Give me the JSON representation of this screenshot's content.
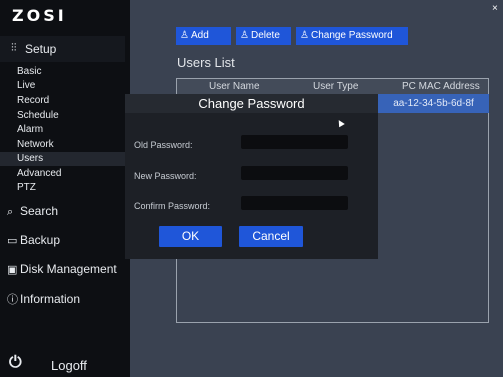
{
  "sidebar": {
    "logo": "ZOSI",
    "setup": {
      "icon": "settings-sliders-icon",
      "glyph": "⫶⫶",
      "label": "Setup"
    },
    "sub_items": [
      {
        "label": "Basic"
      },
      {
        "label": "Live"
      },
      {
        "label": "Record"
      },
      {
        "label": "Schedule"
      },
      {
        "label": "Alarm"
      },
      {
        "label": "Network"
      },
      {
        "label": "Users",
        "active": true
      },
      {
        "label": "Advanced"
      },
      {
        "label": "PTZ"
      }
    ],
    "main_items": [
      {
        "icon": "search-icon",
        "glyph": "⌕",
        "label": "Search"
      },
      {
        "icon": "backup-icon",
        "glyph": "▭",
        "label": "Backup"
      },
      {
        "icon": "disk-icon",
        "glyph": "▣",
        "label": "Disk Management"
      },
      {
        "icon": "info-icon",
        "glyph": "ⓘ",
        "label": "Information"
      }
    ],
    "logoff": {
      "icon": "power-icon",
      "glyph": "⏻",
      "label": "Logoff"
    }
  },
  "toolbar": {
    "add": {
      "icon": "user-icon",
      "glyph": "♙",
      "label": "Add"
    },
    "delete": {
      "icon": "user-icon",
      "glyph": "♙",
      "label": "Delete"
    },
    "change_password": {
      "icon": "user-icon",
      "glyph": "♙",
      "label": "Change Password"
    }
  },
  "close_glyph": "×",
  "users": {
    "title": "Users List",
    "columns": [
      "User Name",
      "User Type",
      "PC MAC Address"
    ],
    "selected_mac": "aa-12-34-5b-6d-8f"
  },
  "dialog": {
    "title": "Change Password",
    "fields": [
      {
        "label": "Old Password:",
        "value": ""
      },
      {
        "label": "New Password:",
        "value": ""
      },
      {
        "label": "Confirm Password:",
        "value": ""
      }
    ],
    "ok_label": "OK",
    "cancel_label": "Cancel"
  },
  "colors": {
    "accent": "#1f56d9",
    "selected_row": "#3763b8",
    "sidebar_bg": "#0d0f13",
    "dialog_bg": "#1d2026",
    "content_bg": "#3a4251"
  }
}
